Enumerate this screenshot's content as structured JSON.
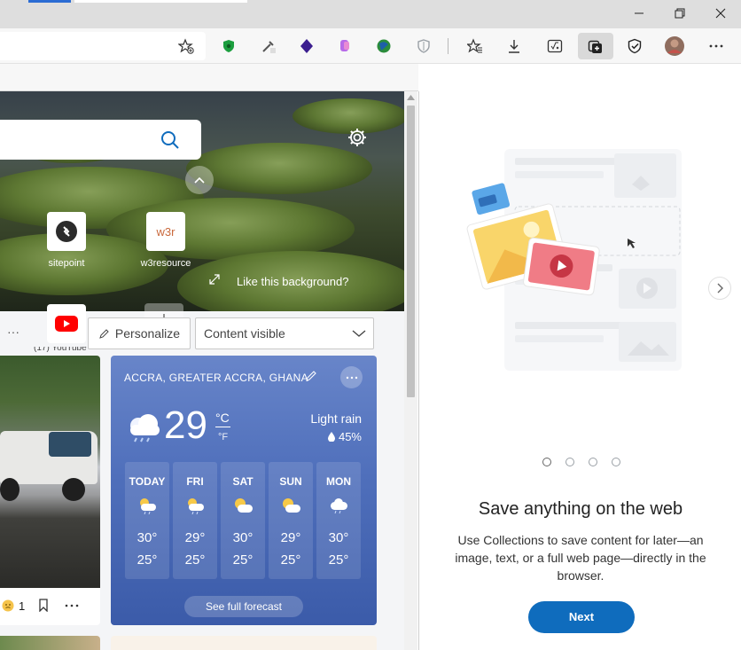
{
  "window": {
    "minimize_icon": "minimize-icon",
    "restore_icon": "restore-icon",
    "close_icon": "close-icon"
  },
  "toolbar": {
    "icons": [
      "add-favorite-icon",
      "shield-extension-icon",
      "eyedropper-extension-icon",
      "hexagon-extension-icon",
      "paint-extension-icon",
      "globe-extension-icon",
      "shield-outline-extension-icon",
      "favorites-icon",
      "downloads-icon",
      "math-solver-icon",
      "collections-icon",
      "browser-essentials-icon",
      "profile-avatar",
      "more-icon"
    ]
  },
  "ntp": {
    "search_icon": "search-icon",
    "settings_icon": "gear-icon",
    "quick_links": [
      {
        "label": "sitepoint"
      },
      {
        "label": "w3resource",
        "logo_text": "w3r"
      },
      {
        "label": "(17) YouTube"
      }
    ],
    "add_tile_icon": "plus-icon",
    "like_background": "Like this background?",
    "more_dots": "···",
    "personalize_label": "Personalize",
    "content_select_value": "Content visible"
  },
  "news_card": {
    "reaction_count": "1"
  },
  "weather": {
    "location": "ACCRA, GREATER ACCRA, GHANA",
    "temperature": "29",
    "unit_c": "°C",
    "unit_f": "°F",
    "condition": "Light rain",
    "precip": "45%",
    "forecast": [
      {
        "day": "TODAY",
        "hi": "30°",
        "lo": "25°"
      },
      {
        "day": "FRI",
        "hi": "29°",
        "lo": "25°"
      },
      {
        "day": "SAT",
        "hi": "30°",
        "lo": "25°"
      },
      {
        "day": "SUN",
        "hi": "29°",
        "lo": "25°"
      },
      {
        "day": "MON",
        "hi": "30°",
        "lo": "25°"
      }
    ],
    "see_full_forecast": "See full forecast"
  },
  "collections_pane": {
    "title": "Save anything on the web",
    "description": "Use Collections to save content for later—an image, text, or a full web page—directly in the browser.",
    "next_label": "Next",
    "active_step": 1,
    "step_count": 4
  },
  "colors": {
    "accent": "#0f6cbd",
    "weather_card": "#4f6fbb"
  }
}
